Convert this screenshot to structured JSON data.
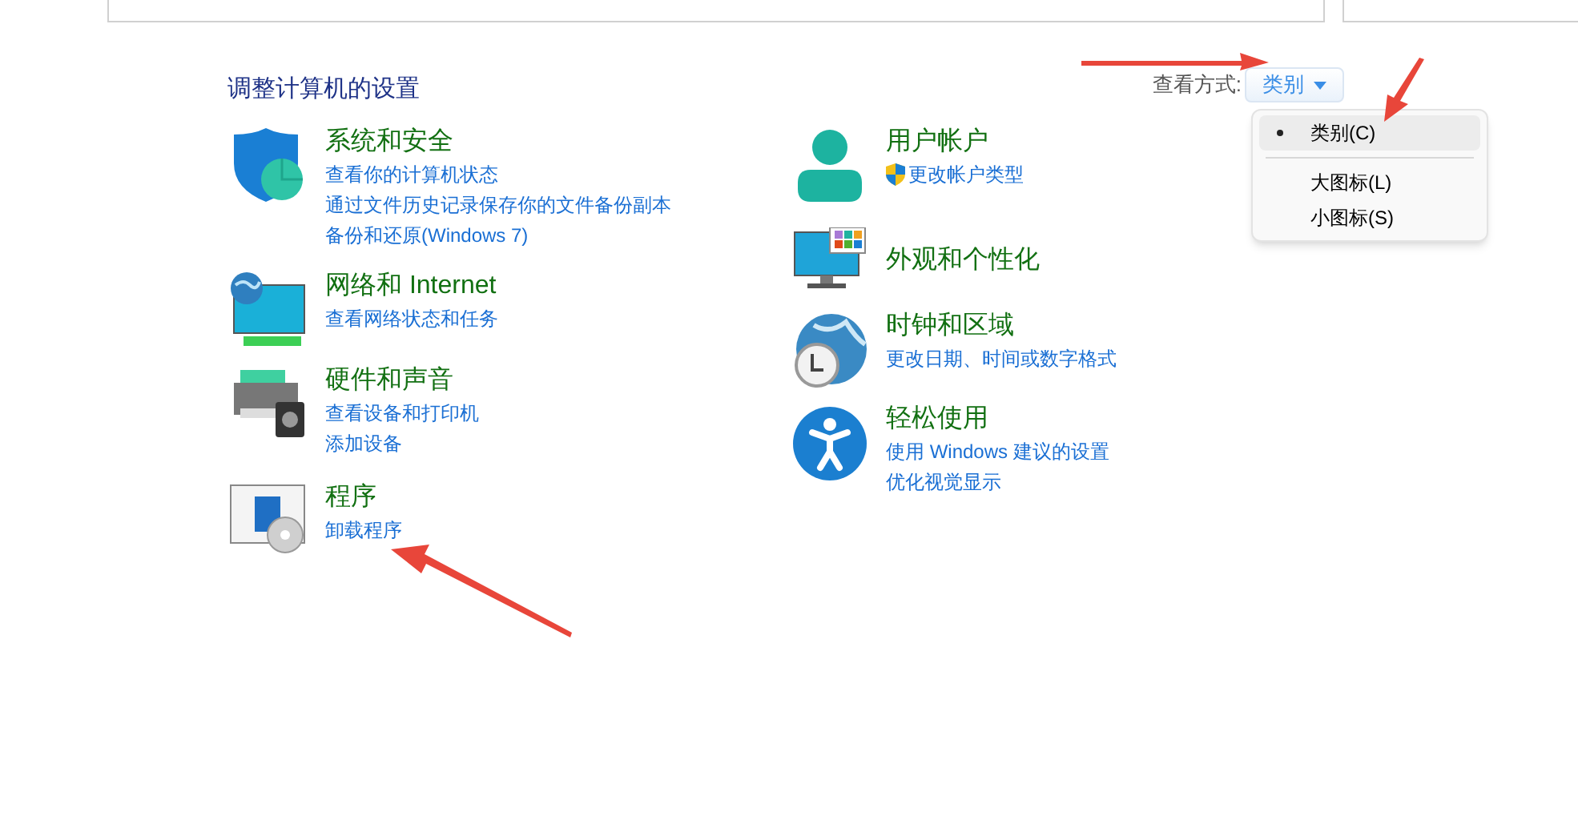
{
  "heading": "调整计算机的设置",
  "view_by": {
    "label": "查看方式:",
    "value": "类别",
    "menu": [
      {
        "kind": "option",
        "label": "类别(C)",
        "selected": true
      },
      {
        "kind": "separator"
      },
      {
        "kind": "option",
        "label": "大图标(L)",
        "selected": false
      },
      {
        "kind": "option",
        "label": "小图标(S)",
        "selected": false
      }
    ]
  },
  "columns": [
    [
      {
        "kind": "security",
        "title": "系统和安全",
        "links": [
          {
            "text": "查看你的计算机状态"
          },
          {
            "text": "通过文件历史记录保存你的文件备份副本"
          },
          {
            "text": "备份和还原(Windows 7)"
          }
        ]
      },
      {
        "kind": "network",
        "title": "网络和 Internet",
        "links": [
          {
            "text": "查看网络状态和任务"
          }
        ]
      },
      {
        "kind": "hardware",
        "title": "硬件和声音",
        "links": [
          {
            "text": "查看设备和打印机"
          },
          {
            "text": "添加设备"
          }
        ]
      },
      {
        "kind": "programs",
        "title": "程序",
        "links": [
          {
            "text": "卸载程序"
          }
        ]
      }
    ],
    [
      {
        "kind": "user",
        "title": "用户帐户",
        "links": [
          {
            "text": "更改帐户类型",
            "shield": true
          }
        ]
      },
      {
        "kind": "appearance",
        "title": "外观和个性化"
      },
      {
        "kind": "clock",
        "title": "时钟和区域",
        "links": [
          {
            "text": "更改日期、时间或数字格式"
          }
        ]
      },
      {
        "kind": "access",
        "title": "轻松使用",
        "links": [
          {
            "text": "使用 Windows 建议的设置"
          },
          {
            "text": "优化视觉显示"
          }
        ]
      }
    ]
  ]
}
